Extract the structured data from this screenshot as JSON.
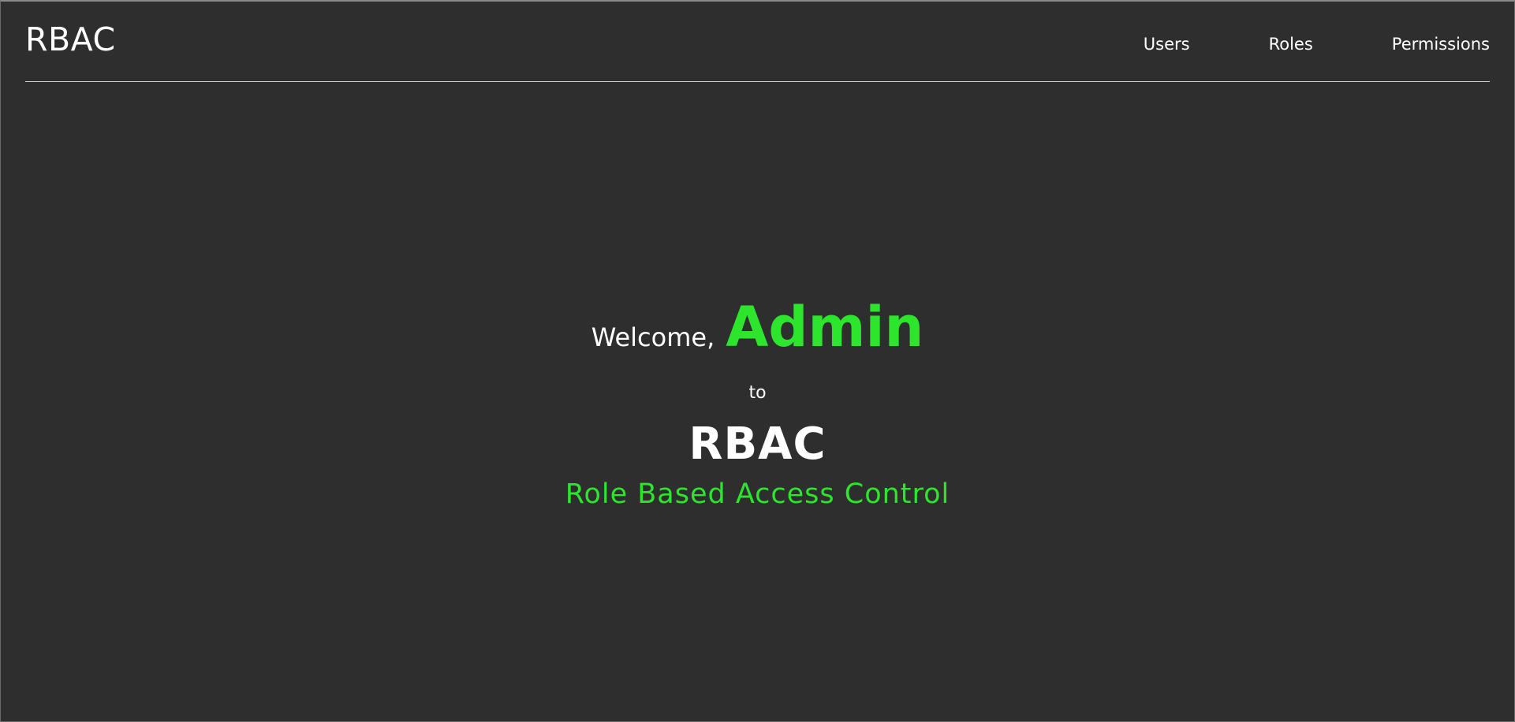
{
  "header": {
    "brand": "RBAC",
    "nav": {
      "users": "Users",
      "roles": "Roles",
      "permissions": "Permissions"
    }
  },
  "hero": {
    "welcome": "Welcome,",
    "user_name": "Admin",
    "connector": "to",
    "app_name": "RBAC",
    "tagline": "Role Based Access Control"
  },
  "colors": {
    "background": "#2e2e2e",
    "accent": "#2ee52e",
    "text": "#ffffff",
    "divider": "#d0d0d0"
  }
}
